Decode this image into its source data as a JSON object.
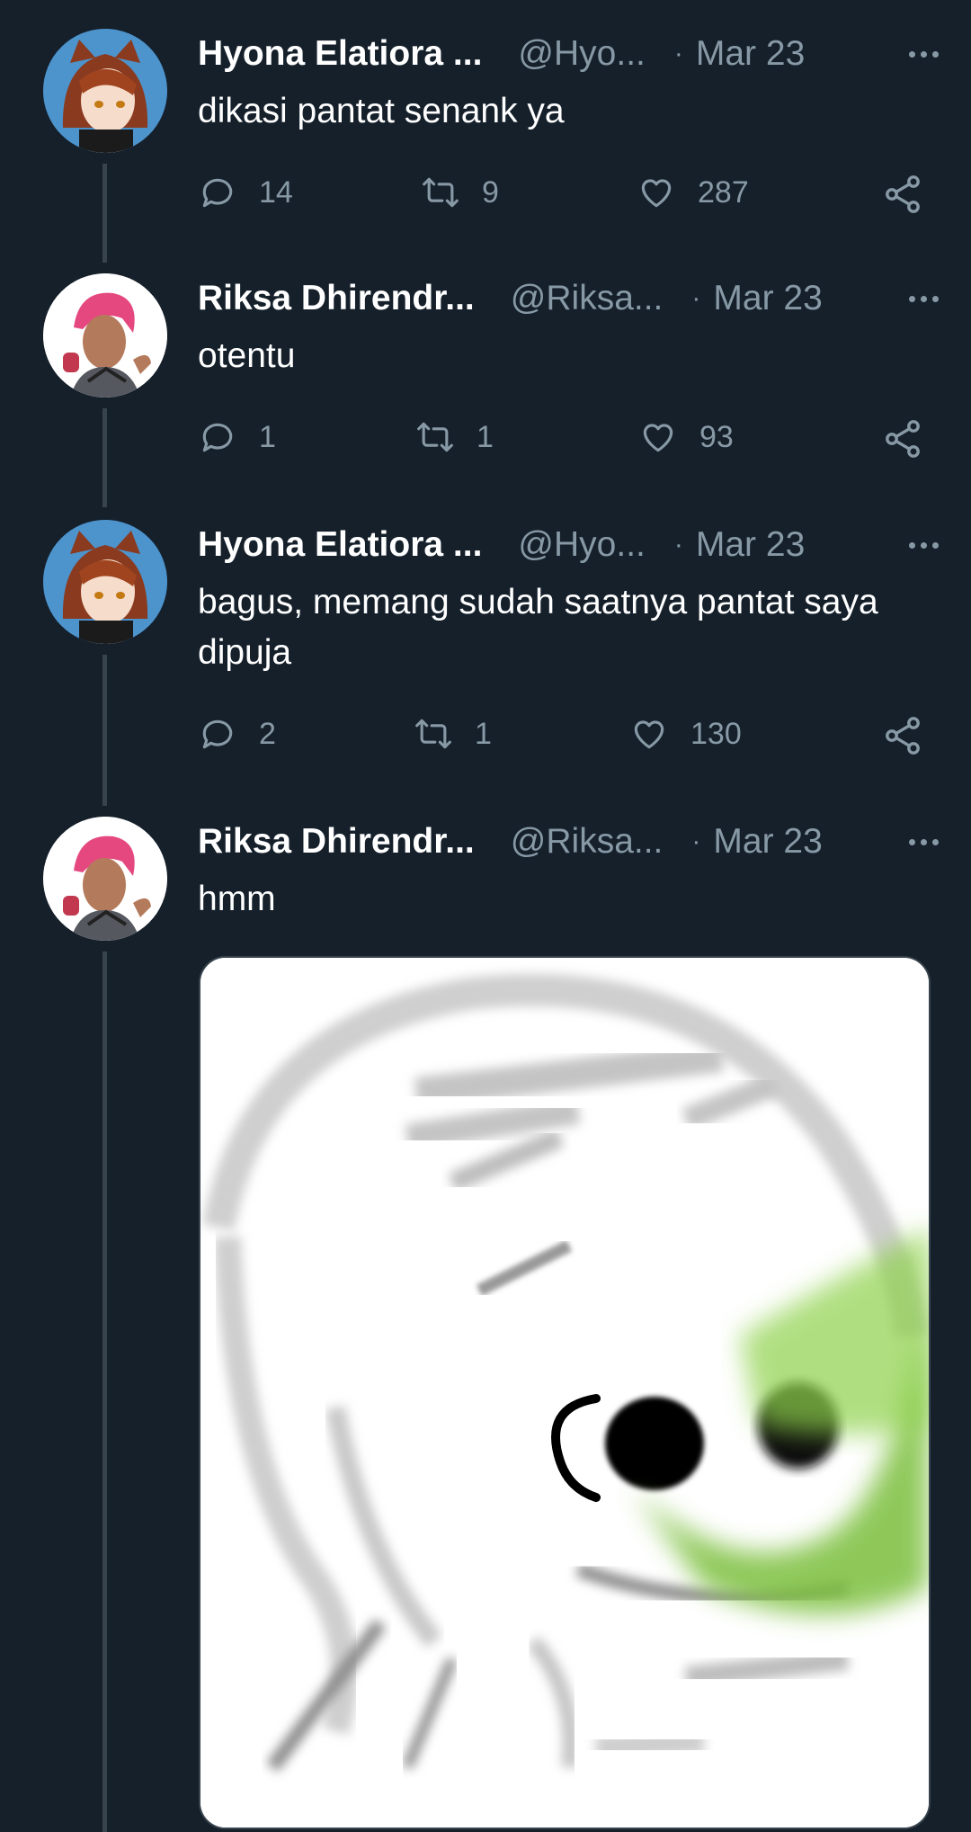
{
  "tweets": [
    {
      "name": "Hyona Elatiora ...",
      "handle": "@Hyo...",
      "dot": "·",
      "date": "Mar 23",
      "text": "dikasi pantat senank ya",
      "replies": "14",
      "retweets": "9",
      "likes": "287"
    },
    {
      "name": "Riksa Dhirendr...",
      "handle": "@Riksa...",
      "dot": "·",
      "date": "Mar 23",
      "text": "otentu",
      "replies": "1",
      "retweets": "1",
      "likes": "93"
    },
    {
      "name": "Hyona Elatiora ...",
      "handle": "@Hyo...",
      "dot": "·",
      "date": "Mar 23",
      "text": "bagus, memang sudah saatnya pantat saya dipuja",
      "replies": "2",
      "retweets": "1",
      "likes": "130"
    },
    {
      "name": "Riksa Dhirendr...",
      "handle": "@Riksa...",
      "dot": "·",
      "date": "Mar 23",
      "text": "hmm"
    }
  ],
  "icons": {
    "reply": "reply-icon",
    "retweet": "retweet-icon",
    "like": "heart-icon",
    "share": "share-icon",
    "more": "more-icon"
  },
  "colors": {
    "background": "#15202b",
    "muted": "#8899a6",
    "thread_line": "#38444d",
    "text": "#ffffff"
  }
}
